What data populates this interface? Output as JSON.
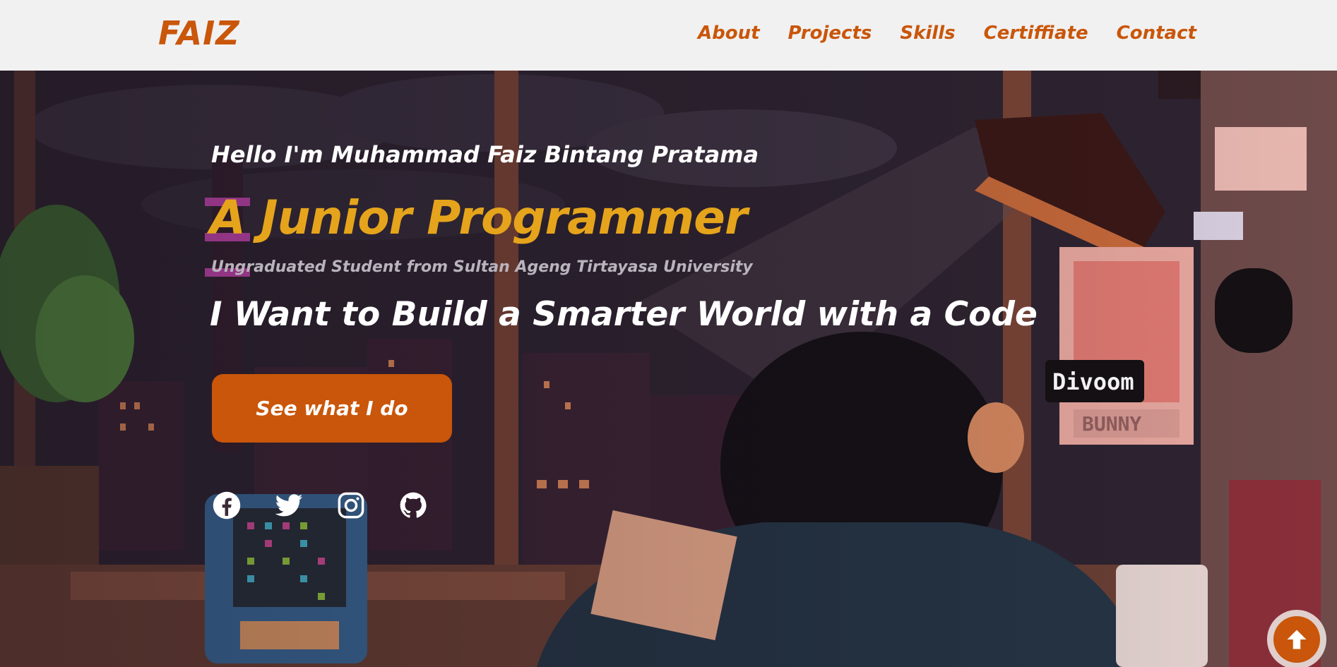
{
  "header": {
    "logo": "FAIZ",
    "nav": [
      {
        "label": "About"
      },
      {
        "label": "Projects"
      },
      {
        "label": "Skills"
      },
      {
        "label": "Certiffiate"
      },
      {
        "label": "Contact"
      }
    ]
  },
  "hero": {
    "greeting": "Hello I'm Muhammad Faiz Bintang Pratama",
    "role": "A Junior Programmer",
    "subtitle": "Ungraduated Student from Sultan Ageng Tirtayasa University",
    "tagline": "I Want to Build a Smarter World with a Code",
    "cta_label": "See what I do",
    "socials": [
      {
        "icon": "facebook-icon"
      },
      {
        "icon": "twitter-icon"
      },
      {
        "icon": "instagram-icon"
      },
      {
        "icon": "github-icon"
      }
    ],
    "poster_brand": "Divoom",
    "poster_text": "BUNNY"
  },
  "colors": {
    "accent": "#c9560a",
    "role_text": "#e5a41b",
    "header_bg": "#f1f1f1"
  }
}
